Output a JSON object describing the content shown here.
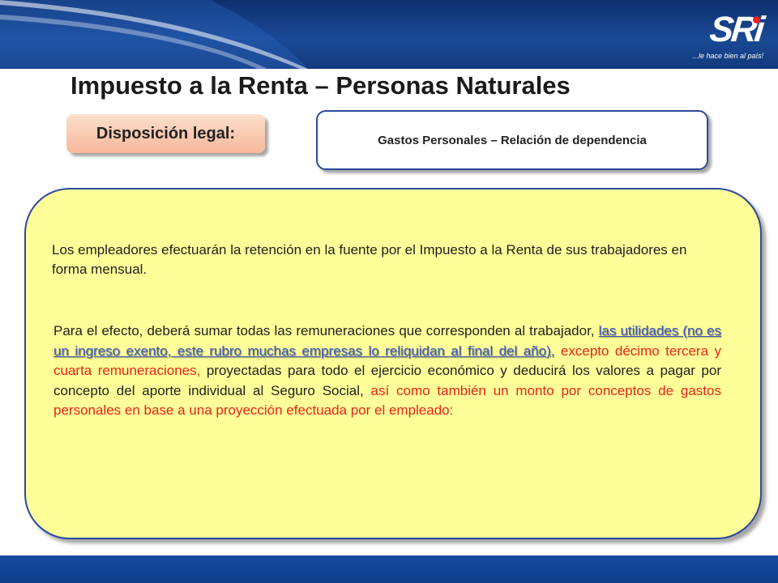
{
  "header": {
    "logo_text": "SRi",
    "logo_tagline": "...le hace bien al país!"
  },
  "title": "Impuesto a la Renta – Personas Naturales",
  "disposicion_label": "Disposición legal:",
  "gastos_box_label": "Gastos Personales – Relación de dependencia",
  "paragraph1": "Los empleadores efectuarán la retención en la fuente por el Impuesto a la Renta de sus trabajadores en forma mensual.",
  "paragraph2": {
    "part_intro": "Para el efecto, deberá sumar todas las remuneraciones que corresponden al trabajador, ",
    "part_link": "las utilidades (no es un ingreso exento, este rubro muchas empresas lo reliquidan al final del año),",
    "part_excepto": " excepto décimo tercera y cuarta remuneraciones,",
    "part_middle": " proyectadas para todo el ejercicio económico y deducirá los valores a pagar por concepto del aporte individual al Seguro Social,",
    "part_red": " así como también un monto por conceptos de gastos personales en base a una proyección efectuada por el empleado:"
  },
  "colors": {
    "header_blue": "#1a4a96",
    "panel_yellow": "#ffff99",
    "button_peach": "#f7b79a",
    "red_text": "#e8241b",
    "link_blue": "#3b59c4"
  }
}
